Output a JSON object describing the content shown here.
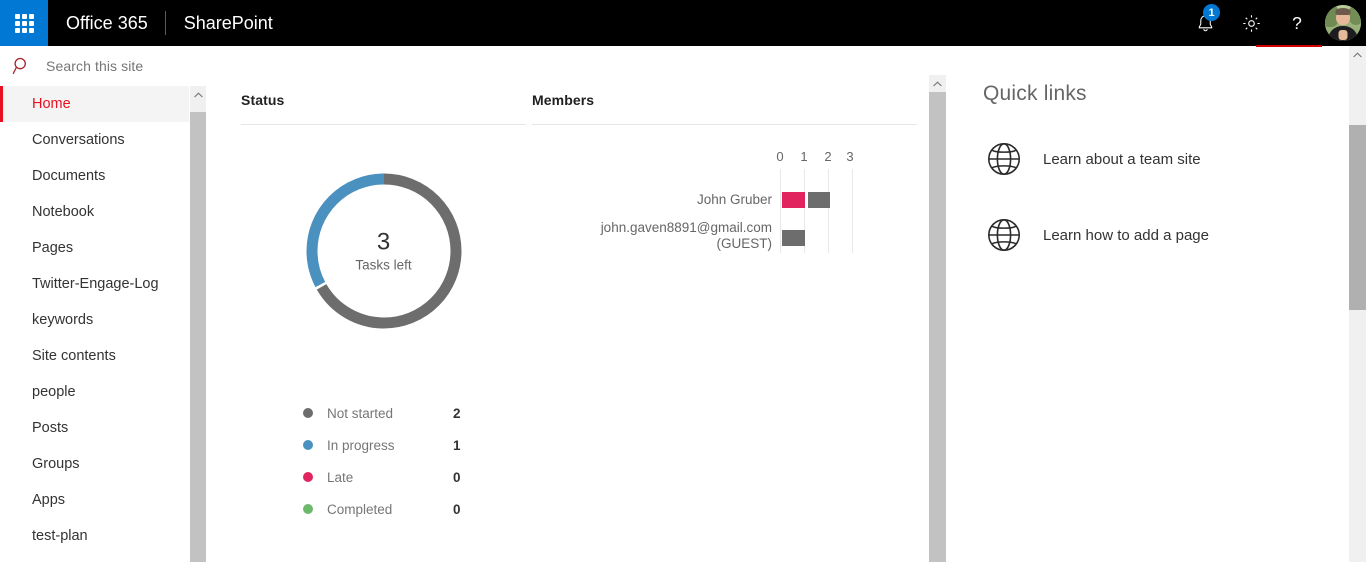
{
  "suite": {
    "waffle_label": "app-launcher",
    "brand": "Office 365",
    "app": "SharePoint",
    "notifications_badge": "1",
    "icons": {
      "bell": "bell-icon",
      "settings": "gear-icon",
      "help": "help-icon",
      "avatar": "user-avatar"
    }
  },
  "search": {
    "placeholder": "Search this site",
    "icon": "search-icon"
  },
  "sidebar": {
    "items": [
      {
        "label": "Home",
        "active": true
      },
      {
        "label": "Conversations",
        "active": false
      },
      {
        "label": "Documents",
        "active": false
      },
      {
        "label": "Notebook",
        "active": false
      },
      {
        "label": "Pages",
        "active": false
      },
      {
        "label": "Twitter-Engage-Log",
        "active": false
      },
      {
        "label": "keywords",
        "active": false
      },
      {
        "label": "Site contents",
        "active": false
      },
      {
        "label": "people",
        "active": false
      },
      {
        "label": "Posts",
        "active": false
      },
      {
        "label": "Groups",
        "active": false
      },
      {
        "label": "Apps",
        "active": false
      },
      {
        "label": "test-plan",
        "active": false
      }
    ]
  },
  "status_webpart": {
    "title": "Status",
    "center_value": "3",
    "center_label": "Tasks left"
  },
  "members_webpart": {
    "title": "Members"
  },
  "quick_links": {
    "title": "Quick links",
    "items": [
      {
        "label": "Learn about a team site",
        "icon": "globe-icon"
      },
      {
        "label": "Learn how to add a page",
        "icon": "globe-icon"
      }
    ]
  },
  "colors": {
    "not_started": "#6d6d6d",
    "in_progress": "#4a91c0",
    "late": "#e1255f",
    "completed": "#6cb96c",
    "accent_blue": "#0078d4",
    "accent_red": "#e81123"
  },
  "chart_data": [
    {
      "type": "pie",
      "title": "Status",
      "subtitle": "Tasks left",
      "center_value": 3,
      "donut": true,
      "categories": [
        "Not started",
        "In progress",
        "Late",
        "Completed"
      ],
      "values": [
        2,
        1,
        0,
        0
      ],
      "colors": [
        "#6d6d6d",
        "#4a91c0",
        "#e1255f",
        "#6cb96c"
      ],
      "legend": "bottom",
      "legend_entries": [
        {
          "label": "Not started",
          "value": "2",
          "color": "#6d6d6d"
        },
        {
          "label": "In progress",
          "value": "1",
          "color": "#4a91c0"
        },
        {
          "label": "Late",
          "value": "0",
          "color": "#e1255f"
        },
        {
          "label": "Completed",
          "value": "0",
          "color": "#6cb96c"
        }
      ]
    },
    {
      "type": "bar",
      "orientation": "horizontal",
      "stacked": true,
      "title": "Members",
      "xlabel": "",
      "ylabel": "",
      "xlim": [
        0,
        3
      ],
      "xticks": [
        "0",
        "1",
        "2",
        "3"
      ],
      "grid": true,
      "categories": [
        "John Gruber",
        "john.gaven8891@gmail.com\n(GUEST)"
      ],
      "series": [
        {
          "name": "Late",
          "color": "#e1255f",
          "values": [
            1,
            0
          ]
        },
        {
          "name": "Not started",
          "color": "#6d6d6d",
          "values": [
            1,
            1
          ]
        }
      ]
    }
  ]
}
